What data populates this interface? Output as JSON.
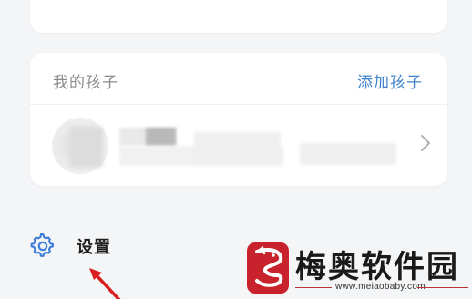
{
  "kids": {
    "title": "我的孩子",
    "add_label": "添加孩子"
  },
  "settings": {
    "label": "设置",
    "icon": "gear-icon"
  },
  "watermark": {
    "name": "梅奥软件园",
    "url": "www.meiaobaby.com"
  },
  "colors": {
    "accent": "#3f83c9",
    "settings_icon": "#3b7dd8",
    "annotation_arrow": "#d81e1e",
    "watermark_red": "#c0303a"
  }
}
